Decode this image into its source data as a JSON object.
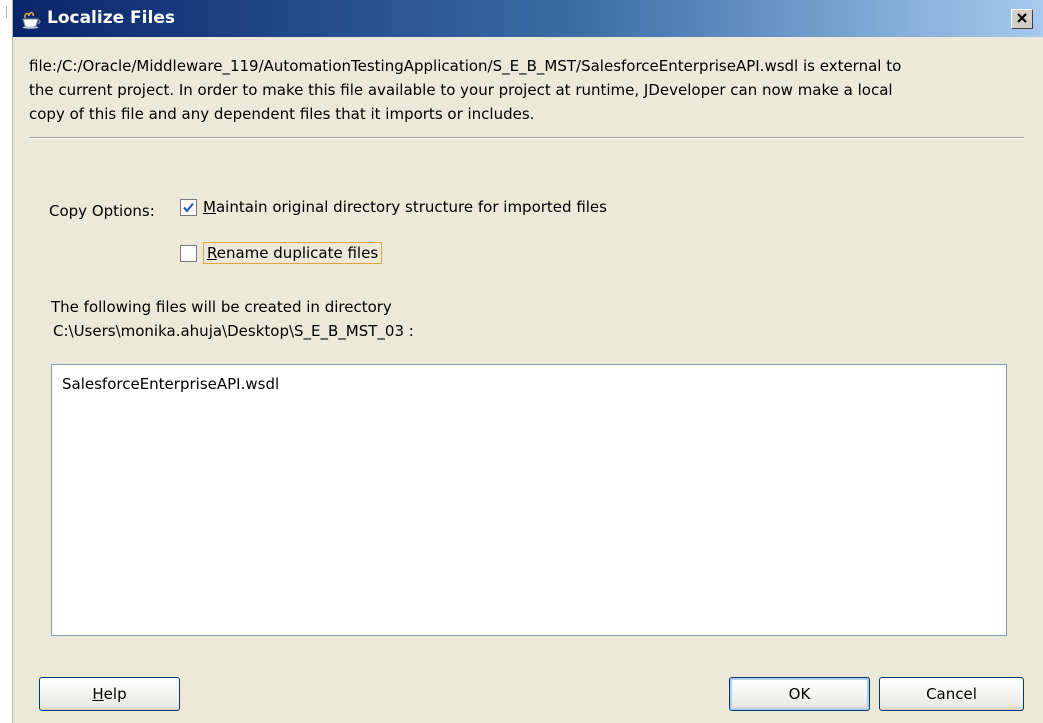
{
  "window": {
    "title": "Localize Files",
    "close_icon": "close-x-icon",
    "title_icon": "jdeveloper-cup-icon"
  },
  "message": {
    "line1": "file:/C:/Oracle/Middleware_119/AutomationTestingApplication/S_E_B_MST/SalesforceEnterpriseAPI.wsdl is external to",
    "line2": "the current project. In order to make this file available to your project at runtime, JDeveloper can now make a local",
    "line3": "copy of this file and any dependent files that it imports or includes."
  },
  "copy_options": {
    "label": "Copy Options:",
    "maintain": {
      "checked": true,
      "mnemonic": "M",
      "rest": "aintain original directory structure for imported files"
    },
    "rename": {
      "checked": false,
      "mnemonic": "R",
      "rest": "ename duplicate files"
    }
  },
  "directory": {
    "intro": "The following files will be created in directory",
    "path": "C:\\Users\\monika.ahuja\\Desktop\\S_E_B_MST_03 :"
  },
  "files": [
    "SalesforceEnterpriseAPI.wsdl"
  ],
  "buttons": {
    "help_mnemonic": "H",
    "help_rest": "elp",
    "ok": "OK",
    "cancel": "Cancel"
  },
  "colors": {
    "titlebar_start": "#0a246a",
    "titlebar_end": "#a6caf0",
    "dialog_bg": "#ece9d8",
    "focus_border": "#e8a43c",
    "check_mark": "#2b5fc9"
  }
}
